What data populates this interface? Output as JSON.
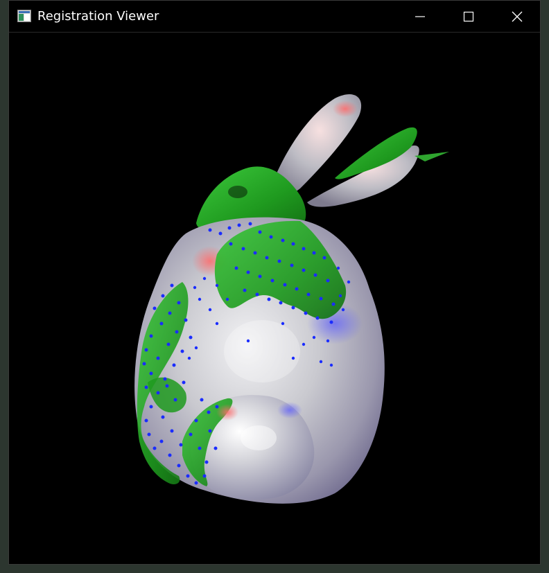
{
  "window": {
    "title": "Registration Viewer",
    "icon": "app-window-icon"
  },
  "controls": {
    "minimize_icon": "minimize-icon",
    "maximize_icon": "maximize-icon",
    "close_icon": "close-icon"
  },
  "viewport": {
    "background": "#000000",
    "model_color": "#c8c8cc",
    "overlay_color": "#2aa52a",
    "point_color": "#1a2cff"
  }
}
